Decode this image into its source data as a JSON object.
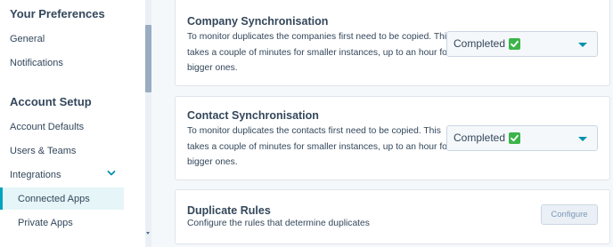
{
  "sidebar": {
    "preferences_title": "Your Preferences",
    "preferences_items": [
      {
        "label": "General"
      },
      {
        "label": "Notifications"
      }
    ],
    "account_title": "Account Setup",
    "account_items": [
      {
        "label": "Account Defaults"
      },
      {
        "label": "Users & Teams"
      },
      {
        "label": "Integrations"
      }
    ],
    "integrations_sub": [
      {
        "label": "Connected Apps",
        "active": true
      },
      {
        "label": "Private Apps"
      }
    ]
  },
  "cards": {
    "company": {
      "title": "Company Synchronisation",
      "description": "To monitor duplicates the companies first need to be copied. This takes a couple of minutes for smaller instances, up to an hour for bigger ones.",
      "status": "Completed"
    },
    "contact": {
      "title": "Contact Synchronisation",
      "description": "To monitor duplicates the contacts first need to be copied. This takes a couple of minutes for smaller instances, up to an hour for bigger ones.",
      "status": "Completed"
    },
    "rules": {
      "title": "Duplicate Rules",
      "description": "Configure the rules that determine duplicates",
      "button_label": "Configure"
    }
  },
  "colors": {
    "accent": "#00a4bd",
    "check_green": "#3bb54a",
    "text": "#33475b"
  },
  "icons": {
    "status_check": "check-mark-icon",
    "integrations_toggle": "chevron-down-icon",
    "select_caret": "caret-down-icon"
  }
}
